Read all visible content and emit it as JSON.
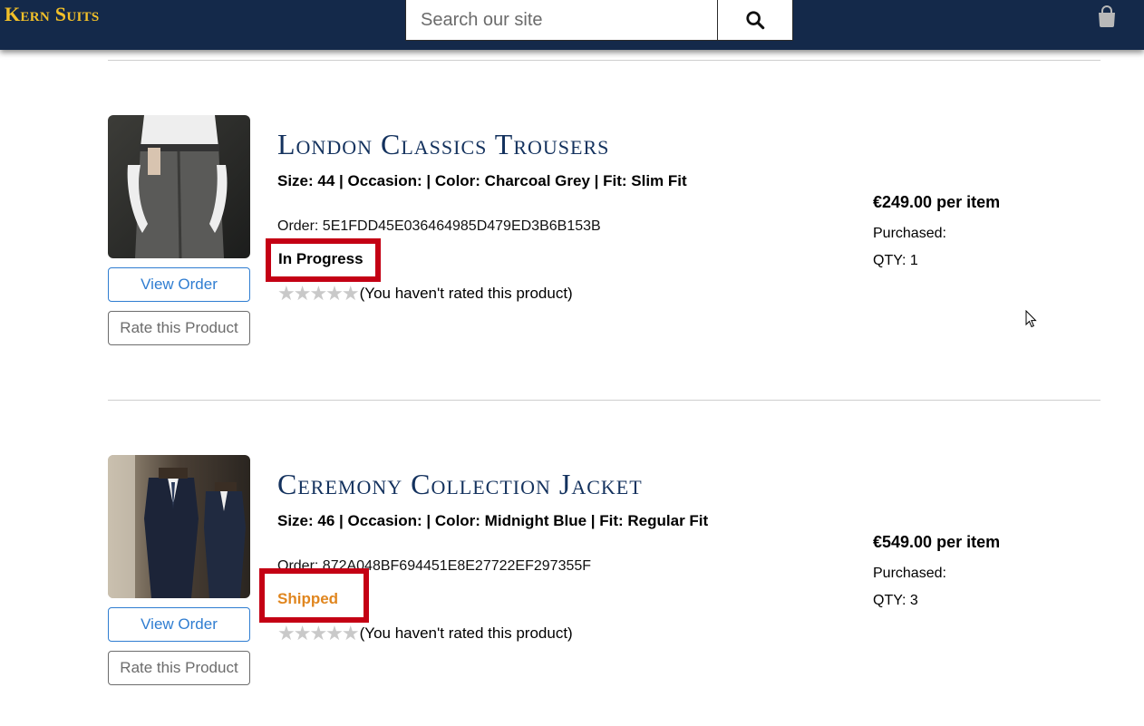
{
  "header": {
    "logo": "Kern Suits",
    "search_placeholder": "Search our site",
    "search_icon": "search-icon",
    "cart_icon": "shopping-bag-icon"
  },
  "orders": [
    {
      "title": "London Classics Trousers",
      "specs": "Size: 44 | Occasion: | Color: Charcoal Grey | Fit: Slim Fit",
      "order": "Order: 5E1FDD45E036464985D479ED3B6B153B",
      "status": "In Progress",
      "status_color": "#000000",
      "rating_text": "(You haven't rated this product)",
      "rating_value": 0,
      "price": "€249.00",
      "price_suffix": " per item",
      "purchased": "Purchased:",
      "qty": "QTY: 1",
      "view_label": "View Order",
      "rate_label": "Rate this Product"
    },
    {
      "title": "Ceremony Collection Jacket",
      "specs": "Size: 46 | Occasion: | Color: Midnight Blue | Fit: Regular Fit",
      "order": "Order: 872A048BF694451E8E27722EF297355F",
      "status": "Shipped",
      "status_color": "#e0861f",
      "rating_text": "(You haven't rated this product)",
      "rating_value": 0,
      "price": "€549.00",
      "price_suffix": " per item",
      "purchased": "Purchased:",
      "qty": "QTY: 3",
      "view_label": "View Order",
      "rate_label": "Rate this Product"
    }
  ],
  "colors": {
    "header_bg": "#14294a",
    "logo": "#f2c029",
    "title": "#14325e",
    "link": "#2f7dd1",
    "highlight": "#c40014"
  }
}
